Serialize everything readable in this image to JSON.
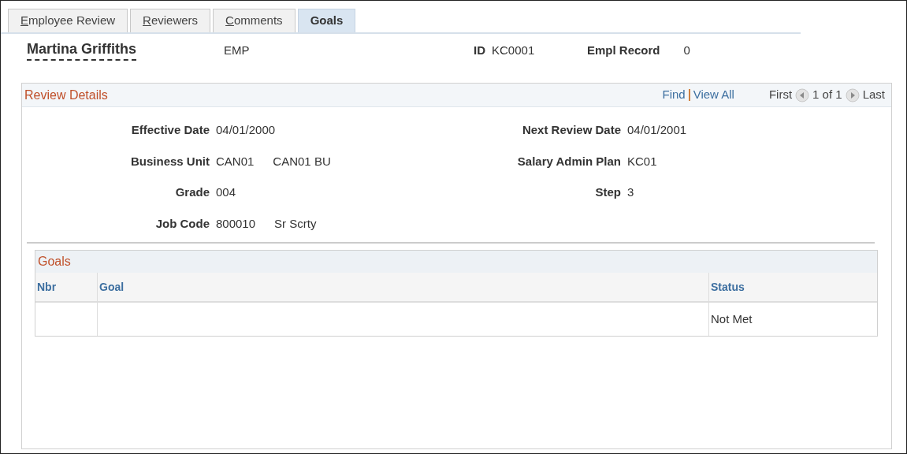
{
  "tabs": [
    {
      "label": "Employee Review",
      "selected": false,
      "underlined_first_letter": true
    },
    {
      "label": "Reviewers",
      "selected": false,
      "underlined_first_letter": true
    },
    {
      "label": "Comments",
      "selected": false,
      "underlined_first_letter": true
    },
    {
      "label": "Goals",
      "selected": true,
      "underlined_first_letter": false
    }
  ],
  "header": {
    "name": "Martina Griffiths",
    "type": "EMP",
    "id_label": "ID",
    "id_value": "KC0001",
    "record_label": "Empl Record",
    "record_value": "0"
  },
  "review_details": {
    "title": "Review Details",
    "find": "Find",
    "view_all": "View All",
    "first": "First",
    "count": "1 of 1",
    "last": "Last",
    "left_fields": [
      {
        "label": "Effective Date",
        "values": [
          "04/01/2000"
        ]
      },
      {
        "label": "Business Unit",
        "values": [
          "CAN01",
          "CAN01 BU"
        ]
      },
      {
        "label": "Grade",
        "values": [
          "004"
        ]
      },
      {
        "label": "Job Code",
        "values": [
          "800010",
          "Sr Scrty"
        ]
      }
    ],
    "right_fields": [
      {
        "label": "Next Review Date",
        "values": [
          "04/01/2001"
        ]
      },
      {
        "label": "Salary Admin Plan",
        "values": [
          "KC01"
        ]
      },
      {
        "label": "Step",
        "values": [
          "3"
        ]
      }
    ]
  },
  "goals": {
    "title": "Goals",
    "columns": [
      "Nbr",
      "Goal",
      "Status"
    ],
    "rows": [
      [
        "",
        "",
        "Not Met"
      ]
    ]
  }
}
